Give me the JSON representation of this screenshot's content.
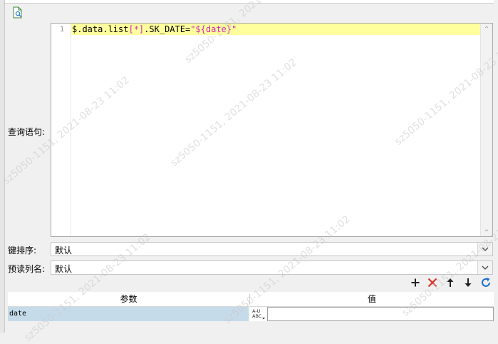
{
  "form": {
    "query_label": "查询语句:",
    "key_sort_label": "键排序:",
    "key_sort_value": "默认",
    "preview_label": "预读列名:",
    "preview_value": "默认"
  },
  "editor": {
    "line_numbers": [
      "1"
    ],
    "code": {
      "part1": "$.data.list",
      "part2": "[*]",
      "part3": ".SK_DATE=",
      "part4": "\"${date}\""
    }
  },
  "params": {
    "col_name": "参数",
    "col_value": "值",
    "rows": [
      {
        "name": "date",
        "value": ""
      }
    ],
    "type_icon_text": "A-U\nABC"
  },
  "toolbar": {
    "icons": [
      "add-icon",
      "delete-icon",
      "move-up-icon",
      "move-down-icon",
      "refresh-icon"
    ]
  },
  "watermark": "sz5050-1151, 2021-08-23 11:02",
  "colors": {
    "code_highlight": "#ffff9e",
    "param_row": "#c6dbea",
    "delete": "#e0312a",
    "refresh": "#1e6fd0"
  }
}
